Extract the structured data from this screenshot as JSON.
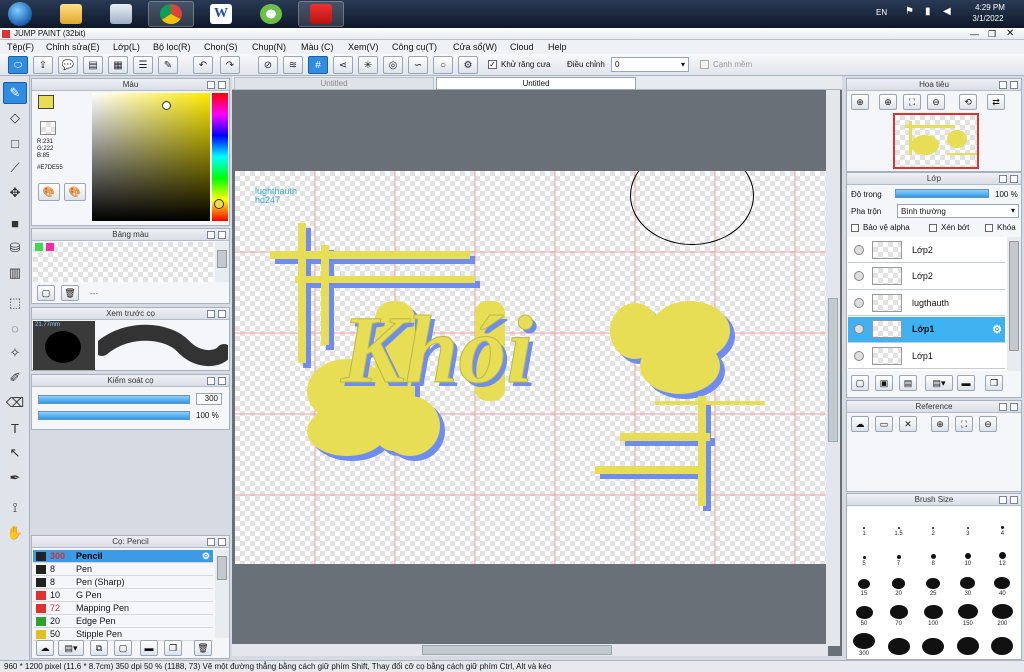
{
  "taskbar": {
    "time": "4:29 PM",
    "date": "3/1/2022",
    "lang": "EN"
  },
  "app": {
    "title": "JUMP PAINT (32bit)"
  },
  "menu": [
    "Tệp(F)",
    "Chỉnh sửa(E)",
    "Lớp(L)",
    "Bộ lọc(R)",
    "Chọn(S)",
    "Chụp(N)",
    "Màu (C)",
    "Xem(V)",
    "Công cụ(T)",
    "Cửa sổ(W)",
    "Cloud",
    "Help"
  ],
  "toolbar": {
    "antialias_label": "Khử răng cưa",
    "adjust_label": "Điều chỉnh",
    "adjust_value": "0",
    "sharp_edge_label": "Cạnh mềm"
  },
  "color_panel": {
    "title": "Màu",
    "r": "R:231",
    "g": "G:222",
    "b": "B:85",
    "hex": "#E7DE55",
    "current_color": "#e7de55"
  },
  "swatch_panel": {
    "title": "Bảng màu",
    "more": "---"
  },
  "brush_preview": {
    "title": "Xem trước cọ",
    "size": "21.77mm"
  },
  "brush_control": {
    "title": "Kiểm soát cọ",
    "size_value": "300",
    "opacity_value": "100 %"
  },
  "brush_list": {
    "title": "Cọ: Pencil",
    "items": [
      {
        "size": "300",
        "name": "Pencil",
        "color": "#222222",
        "size_color": "#d03030"
      },
      {
        "size": "8",
        "name": "Pen",
        "color": "#222222",
        "size_color": "#111111"
      },
      {
        "size": "8",
        "name": "Pen (Sharp)",
        "color": "#222222",
        "size_color": "#111111"
      },
      {
        "size": "10",
        "name": "G Pen",
        "color": "#e03030",
        "size_color": "#111111"
      },
      {
        "size": "72",
        "name": "Mapping Pen",
        "color": "#e03030",
        "size_color": "#d03030"
      },
      {
        "size": "20",
        "name": "Edge Pen",
        "color": "#30a030",
        "size_color": "#111111"
      },
      {
        "size": "50",
        "name": "Stipple Pen",
        "color": "#e0c020",
        "size_color": "#111111"
      }
    ]
  },
  "tabs": [
    "Untitled",
    "Untitled"
  ],
  "canvas": {
    "watermark_line1": "lughthauth",
    "watermark_line2": "hd247",
    "art_text": "Khói",
    "art_color": "#e7de55",
    "shadow_color": "#6f8cf0"
  },
  "navigator": {
    "title": "Hoa tiêu"
  },
  "layer_panel": {
    "title": "Lớp",
    "opacity_label": "Độ trong",
    "opacity_value": "100 %",
    "blend_label": "Pha trộn",
    "blend_value": "Bình thường",
    "protect_alpha": "Bảo vệ alpha",
    "clip": "Xén bớt",
    "lock": "Khóa",
    "layers": [
      {
        "name": "Lớp2"
      },
      {
        "name": "Lớp2"
      },
      {
        "name": "lugthauth"
      },
      {
        "name": "Lớp1",
        "selected": true
      },
      {
        "name": "Lớp1"
      }
    ]
  },
  "reference_panel": {
    "title": "Reference"
  },
  "brush_size_panel": {
    "title": "Brush Size",
    "sizes": [
      "1",
      "1.5",
      "2",
      "3",
      "4",
      "5",
      "7",
      "8",
      "10",
      "12",
      "15",
      "20",
      "25",
      "30",
      "40",
      "50",
      "70",
      "100",
      "150",
      "200",
      "300",
      "",
      "",
      "",
      ""
    ]
  },
  "status": {
    "text": "960 * 1200 pixel  (11.6 * 8.7cm)  350 dpi  50 %  (1188, 73)  Vẽ một đường thẳng bằng cách giữ phím Shift, Thay đổi cỡ cọ bằng cách giữ phím Ctrl, Alt và kéo"
  }
}
